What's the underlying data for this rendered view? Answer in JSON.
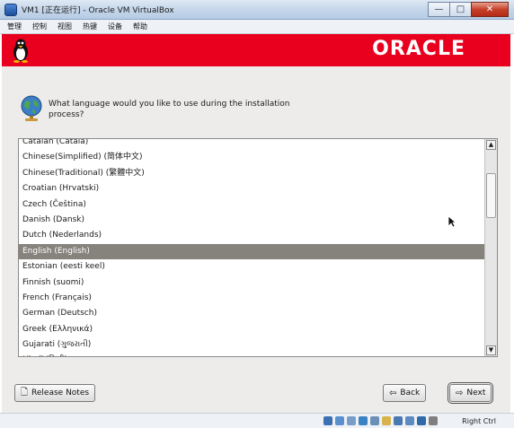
{
  "window": {
    "title": "VM1 [正在运行] - Oracle VM VirtualBox",
    "minimize": "—",
    "maximize": "□",
    "close": "✕"
  },
  "menu": [
    "管理",
    "控制",
    "视图",
    "热键",
    "设备",
    "帮助"
  ],
  "header": {
    "logo_text": "ORACLE"
  },
  "prompt": "What language would you like to use during the installation process?",
  "languages": [
    "Catalan (Català)",
    "Chinese(Simplified) (简体中文)",
    "Chinese(Traditional) (繁體中文)",
    "Croatian (Hrvatski)",
    "Czech (Čeština)",
    "Danish (Dansk)",
    "Dutch (Nederlands)",
    "English (English)",
    "Estonian (eesti keel)",
    "Finnish (suomi)",
    "French (Français)",
    "German (Deutsch)",
    "Greek (Ελληνικά)",
    "Gujarati (ગુજરાતી)",
    "Hindi (हिन्दी)"
  ],
  "selected_language": "English (English)",
  "buttons": {
    "release_notes": "Release Notes",
    "back": "Back",
    "next": "Next"
  },
  "statusbar": {
    "host_key": "Right Ctrl"
  },
  "colors": {
    "header_red": "#e8001e",
    "selected_row": "#86837d"
  }
}
